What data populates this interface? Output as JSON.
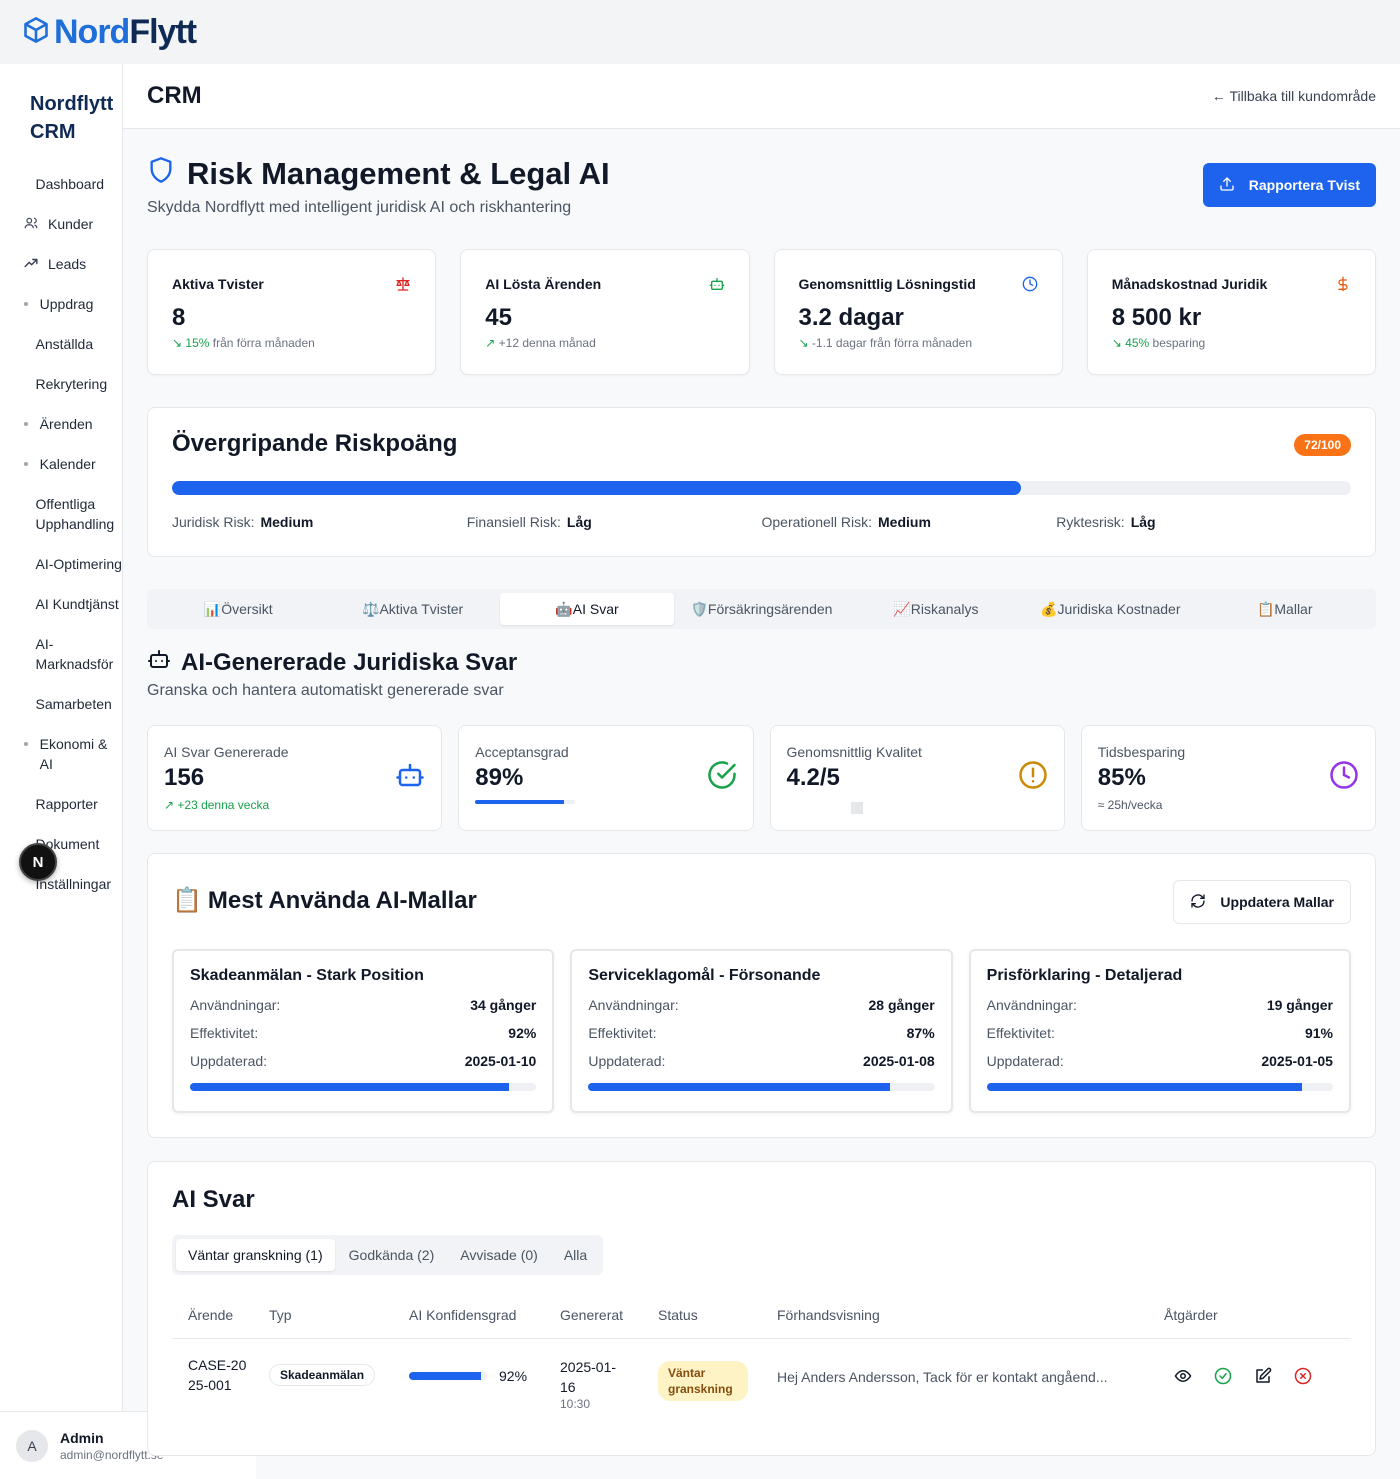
{
  "brand": {
    "nord": "Nord",
    "flytt": "Flytt"
  },
  "sidebar": {
    "title": "Nordflytt CRM",
    "items": [
      {
        "label": "Dashboard",
        "icon": ""
      },
      {
        "label": "Kunder",
        "icon": "users-icon"
      },
      {
        "label": "Leads",
        "icon": "trending-up-icon"
      },
      {
        "label": "Uppdrag",
        "icon": "dot"
      },
      {
        "label": "Anställda",
        "icon": ""
      },
      {
        "label": "Rekrytering",
        "icon": ""
      },
      {
        "label": "Ärenden",
        "icon": "dot"
      },
      {
        "label": "Kalender",
        "icon": "dot"
      },
      {
        "label": "Offentliga Upphandling",
        "icon": ""
      },
      {
        "label": "AI-Optimering",
        "icon": ""
      },
      {
        "label": "AI Kundtjänst",
        "icon": ""
      },
      {
        "label": "AI-Marknadsför",
        "icon": ""
      },
      {
        "label": "Samarbeten",
        "icon": ""
      },
      {
        "label": "Ekonomi & AI",
        "icon": "dot"
      },
      {
        "label": "Rapporter",
        "icon": ""
      },
      {
        "label": "Dokument",
        "icon": ""
      },
      {
        "label": "Inställningar",
        "icon": ""
      }
    ],
    "fab_label": "N",
    "user": {
      "initial": "A",
      "name": "Admin",
      "email": "admin@nordflytt.se"
    }
  },
  "header": {
    "title": "CRM",
    "back_link": "← Tillbaka till kundområde"
  },
  "hero": {
    "title": "Risk Management & Legal AI",
    "subtitle": "Skydda Nordflytt med intelligent juridisk AI och riskhantering",
    "report_button": "Rapportera Tvist"
  },
  "stats": [
    {
      "label": "Aktiva Tvister",
      "value": "8",
      "change_hl": "15%",
      "change_rest": " från förra månaden",
      "arrow": "↘",
      "icon": "scale-icon",
      "color": "#dc2626"
    },
    {
      "label": "AI Lösta Ärenden",
      "value": "45",
      "change_hl": "",
      "change_rest": "+12 denna månad",
      "arrow": "↗",
      "icon": "bot-icon",
      "color": "#16a34a"
    },
    {
      "label": "Genomsnittlig Lösningstid",
      "value": "3.2 dagar",
      "change_hl": "",
      "change_rest": "-1.1 dagar från förra månaden",
      "arrow": "↘",
      "icon": "clock-icon",
      "color": "#1d63ed"
    },
    {
      "label": "Månadskostnad Juridik",
      "value": "8 500 kr",
      "change_hl": "45%",
      "change_rest": " besparing",
      "arrow": "↘",
      "icon": "dollar-icon",
      "color": "#ea580c"
    }
  ],
  "risk": {
    "title": "Övergripande Riskpoäng",
    "badge": "72/100",
    "score": 0.72,
    "facts": [
      {
        "label": "Juridisk Risk:",
        "value": "Medium"
      },
      {
        "label": "Finansiell Risk:",
        "value": "Låg"
      },
      {
        "label": "Operationell Risk:",
        "value": "Medium"
      },
      {
        "label": "Ryktesrisk:",
        "value": "Låg"
      }
    ]
  },
  "tabs": [
    {
      "label": "📊Översikt",
      "active": false
    },
    {
      "label": "⚖️Aktiva Tvister",
      "active": false
    },
    {
      "label": "🤖AI Svar",
      "active": true
    },
    {
      "label": "🛡️Försäkringsärenden",
      "active": false
    },
    {
      "label": "📈Riskanalys",
      "active": false
    },
    {
      "label": "💰Juridiska Kostnader",
      "active": false
    },
    {
      "label": "📋Mallar",
      "active": false
    }
  ],
  "ai_section": {
    "title": "AI-Genererade Juridiska Svar",
    "subtitle": "Granska och hantera automatiskt genererade svar",
    "cards": [
      {
        "label": "AI Svar Genererade",
        "value": "156",
        "note": "↗ +23 denna vecka",
        "icon": "bot-icon",
        "color": "#1d63ed"
      },
      {
        "label": "Acceptansgrad",
        "value": "89%",
        "progress": 0.89,
        "icon": "check-circle-icon",
        "color": "#16a34a"
      },
      {
        "label": "Genomsnittlig Kvalitet",
        "value": "4.2/5",
        "icon": "alert-circle-icon",
        "color": "#ca8a04"
      },
      {
        "label": "Tidsbesparing",
        "value": "85%",
        "note": "≈ 25h/vecka",
        "icon": "clock-icon",
        "color": "#9333ea"
      }
    ]
  },
  "templates": {
    "title": "Mest Använda AI-Mallar",
    "title_emoji": "📋",
    "refresh_button": "Uppdatera Mallar",
    "row_labels": {
      "uses": "Användningar:",
      "efficiency": "Effektivitet:",
      "updated": "Uppdaterad:"
    },
    "items": [
      {
        "name": "Skadeanmälan - Stark Position",
        "uses": "34 gånger",
        "efficiency": "92%",
        "updated": "2025-01-10",
        "progress": 0.92
      },
      {
        "name": "Serviceklagomål - Försonande",
        "uses": "28 gånger",
        "efficiency": "87%",
        "updated": "2025-01-08",
        "progress": 0.87
      },
      {
        "name": "Prisförklaring - Detaljerad",
        "uses": "19 gånger",
        "efficiency": "91%",
        "updated": "2025-01-05",
        "progress": 0.91
      }
    ]
  },
  "responses": {
    "title": "AI Svar",
    "filters": [
      {
        "label": "Väntar granskning (1)",
        "active": true
      },
      {
        "label": "Godkända (2)",
        "active": false
      },
      {
        "label": "Avvisade (0)",
        "active": false
      },
      {
        "label": "Alla",
        "active": false
      }
    ],
    "columns": [
      "Ärende",
      "Typ",
      "AI Konfidensgrad",
      "Genererat",
      "Status",
      "Förhandsvisning",
      "Åtgärder"
    ],
    "rows": [
      {
        "case": "CASE-2025-001",
        "type": "Skadeanmälan",
        "confidence": "92%",
        "confidence_value": 0.92,
        "date": "2025-01-16",
        "time": "10:30",
        "status": "Väntar granskning",
        "preview": "Hej Anders Andersson, Tack för er kontakt angåend..."
      }
    ]
  }
}
